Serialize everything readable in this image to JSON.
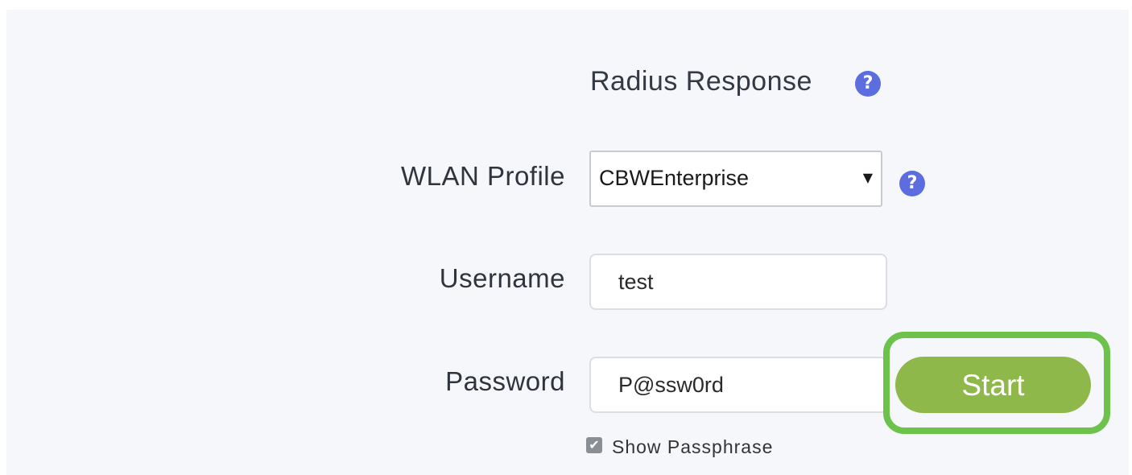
{
  "section": {
    "title": "Radius Response",
    "help_icon": "question-circle-icon"
  },
  "form": {
    "wlan_profile": {
      "label": "WLAN Profile",
      "selected": "CBWEnterprise",
      "help_icon": "question-circle-icon"
    },
    "username": {
      "label": "Username",
      "value": "test"
    },
    "password": {
      "label": "Password",
      "value": "P@ssw0rd"
    },
    "show_passphrase": {
      "label": "Show Passphrase",
      "checked": true
    },
    "start_button": {
      "label": "Start",
      "highlighted": true
    }
  },
  "colors": {
    "help_icon": "#5c6de0",
    "start_button": "#8fb84a",
    "highlight_outline": "#6cc24a",
    "panel_background": "#f6f7fb"
  }
}
